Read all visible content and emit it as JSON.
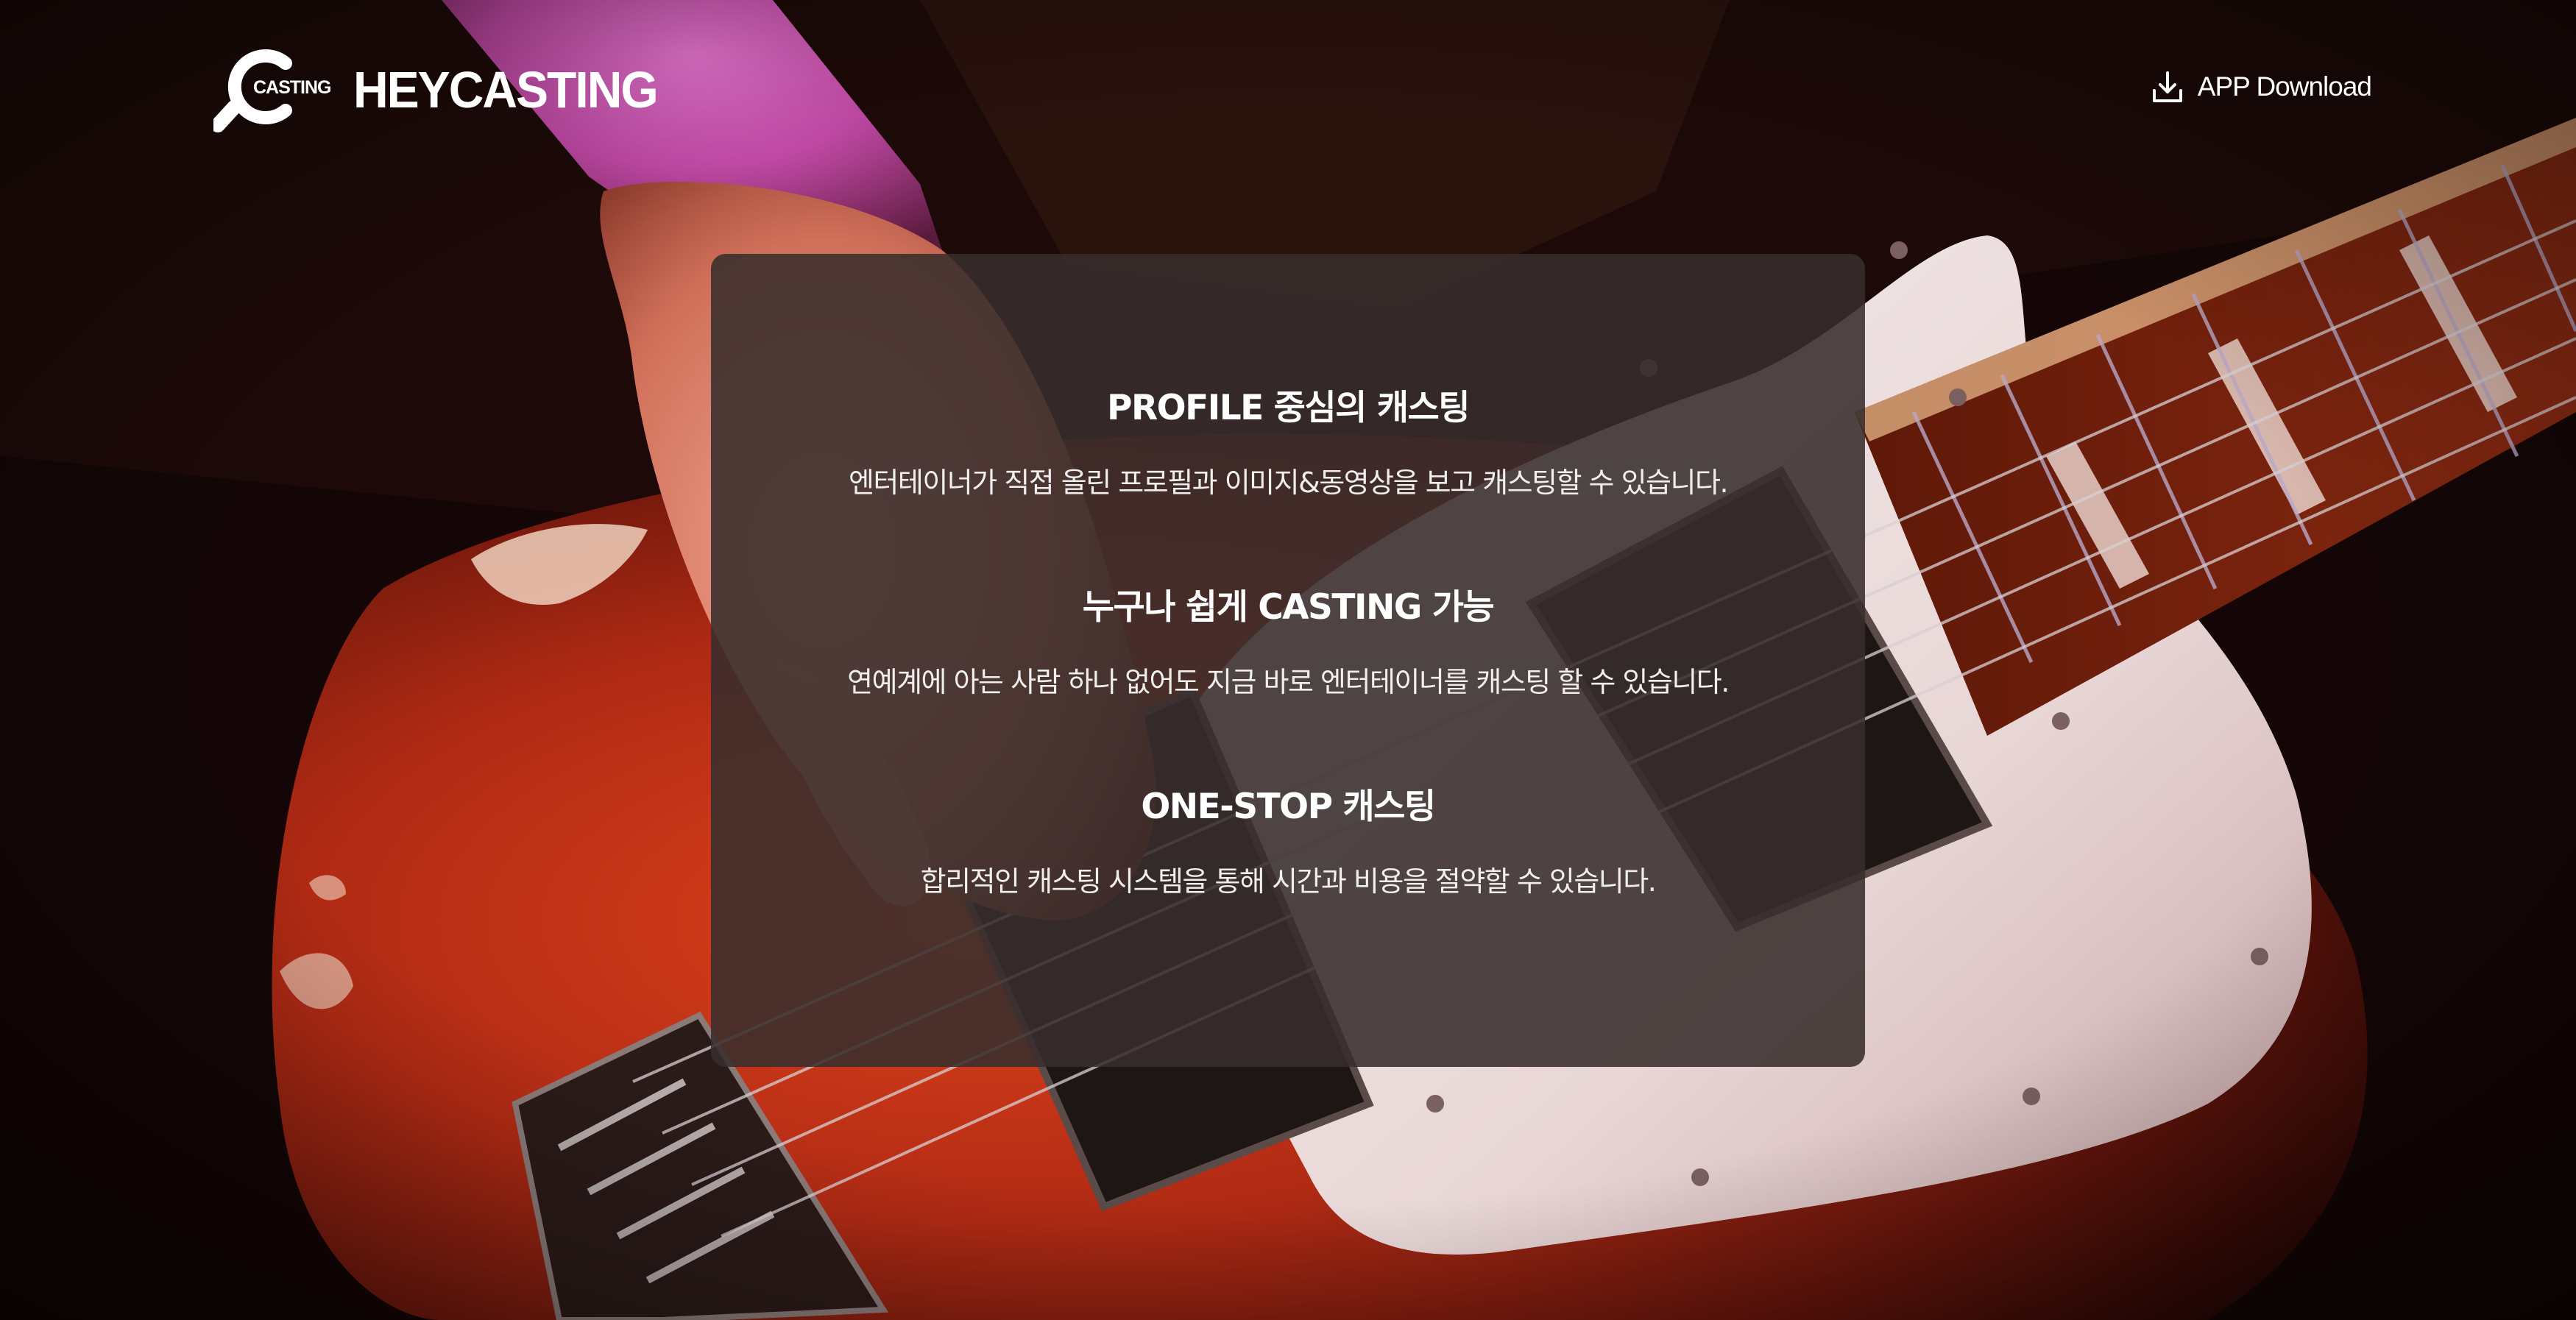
{
  "brand": {
    "logo_mark_text": "CASTING",
    "wordmark": "HEYCASTING"
  },
  "header": {
    "download_label": "APP Download",
    "download_icon": "download-icon"
  },
  "features": [
    {
      "title": "PROFILE 중심의 캐스팅",
      "description": "엔터테이너가 직접 올린 프로필과 이미지&동영상을 보고 캐스팅할 수 있습니다."
    },
    {
      "title": "누구나 쉽게 CASTING 가능",
      "description": "연예계에 아는 사람 하나 없어도 지금 바로 엔터테이너를 캐스팅 할 수 있습니다."
    },
    {
      "title": "ONE-STOP 캐스팅",
      "description": "합리적인 캐스팅 시스템을 통해 시간과 비용을 절약할 수 있습니다."
    }
  ],
  "colors": {
    "panel_background": "#382e2c",
    "text": "#ffffff",
    "background_dark": "#120606",
    "guitar_body": "#c2361a",
    "pickguard": "#ece3e4"
  }
}
